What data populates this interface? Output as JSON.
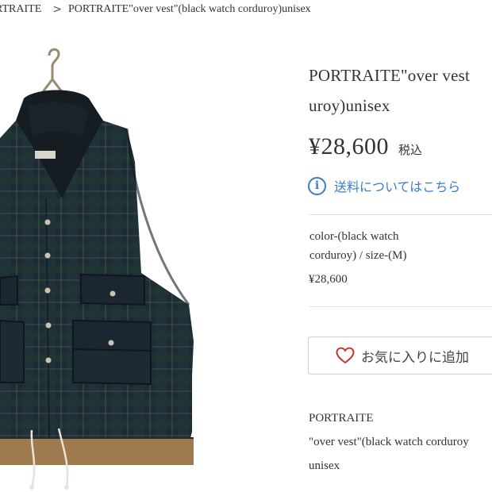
{
  "breadcrumb": {
    "previous": "RTRAITE",
    "separator": ">",
    "current": "PORTRAITE\"over vest\"(black watch corduroy)unisex"
  },
  "product": {
    "title_line1": "PORTRAITE\"over vest",
    "title_line2": "uroy)unisex",
    "price": "¥28,600",
    "tax_label": "税込",
    "shipping_link": "送料についてはこちら",
    "variant_line1": "color-(black watch",
    "variant_line2": "corduroy) / size-(M)",
    "variant_price": "¥28,600",
    "favorite_label": "お気に入りに追加",
    "description": {
      "line1": "PORTRAITE",
      "line2": "\"over vest\"(black watch corduroy",
      "line3": "unisex"
    }
  },
  "icons": {
    "info": "info-circle-icon",
    "heart": "heart-outline-icon"
  },
  "colors": {
    "link": "#3a7dc9",
    "heart": "#c0392b",
    "text": "#333333"
  }
}
